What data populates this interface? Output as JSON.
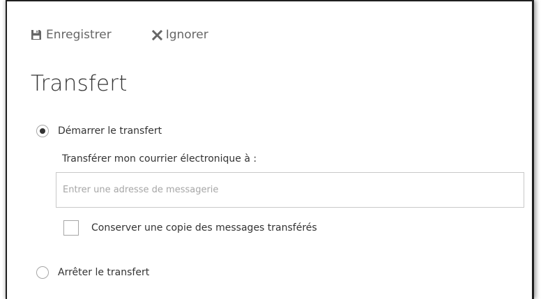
{
  "toolbar": {
    "save_label": "Enregistrer",
    "save_icon": "floppy-disk-icon",
    "discard_label": "Ignorer",
    "discard_icon": "close-x-icon"
  },
  "page": {
    "title": "Transfert"
  },
  "options": {
    "start_label": "Démarrer le transfert",
    "start_selected": true,
    "forward_to_label": "Transférer mon courrier électronique à :",
    "email_placeholder": "Entrer une adresse de messagerie",
    "email_value": "",
    "keep_copy_label": "Conserver une copie des messages transférés",
    "keep_copy_checked": false,
    "stop_label": "Arrêter le transfert",
    "stop_selected": false
  },
  "colors": {
    "text": "#333333",
    "muted": "#666666",
    "border": "#c8c8c8",
    "placeholder": "#a6a6a6"
  }
}
